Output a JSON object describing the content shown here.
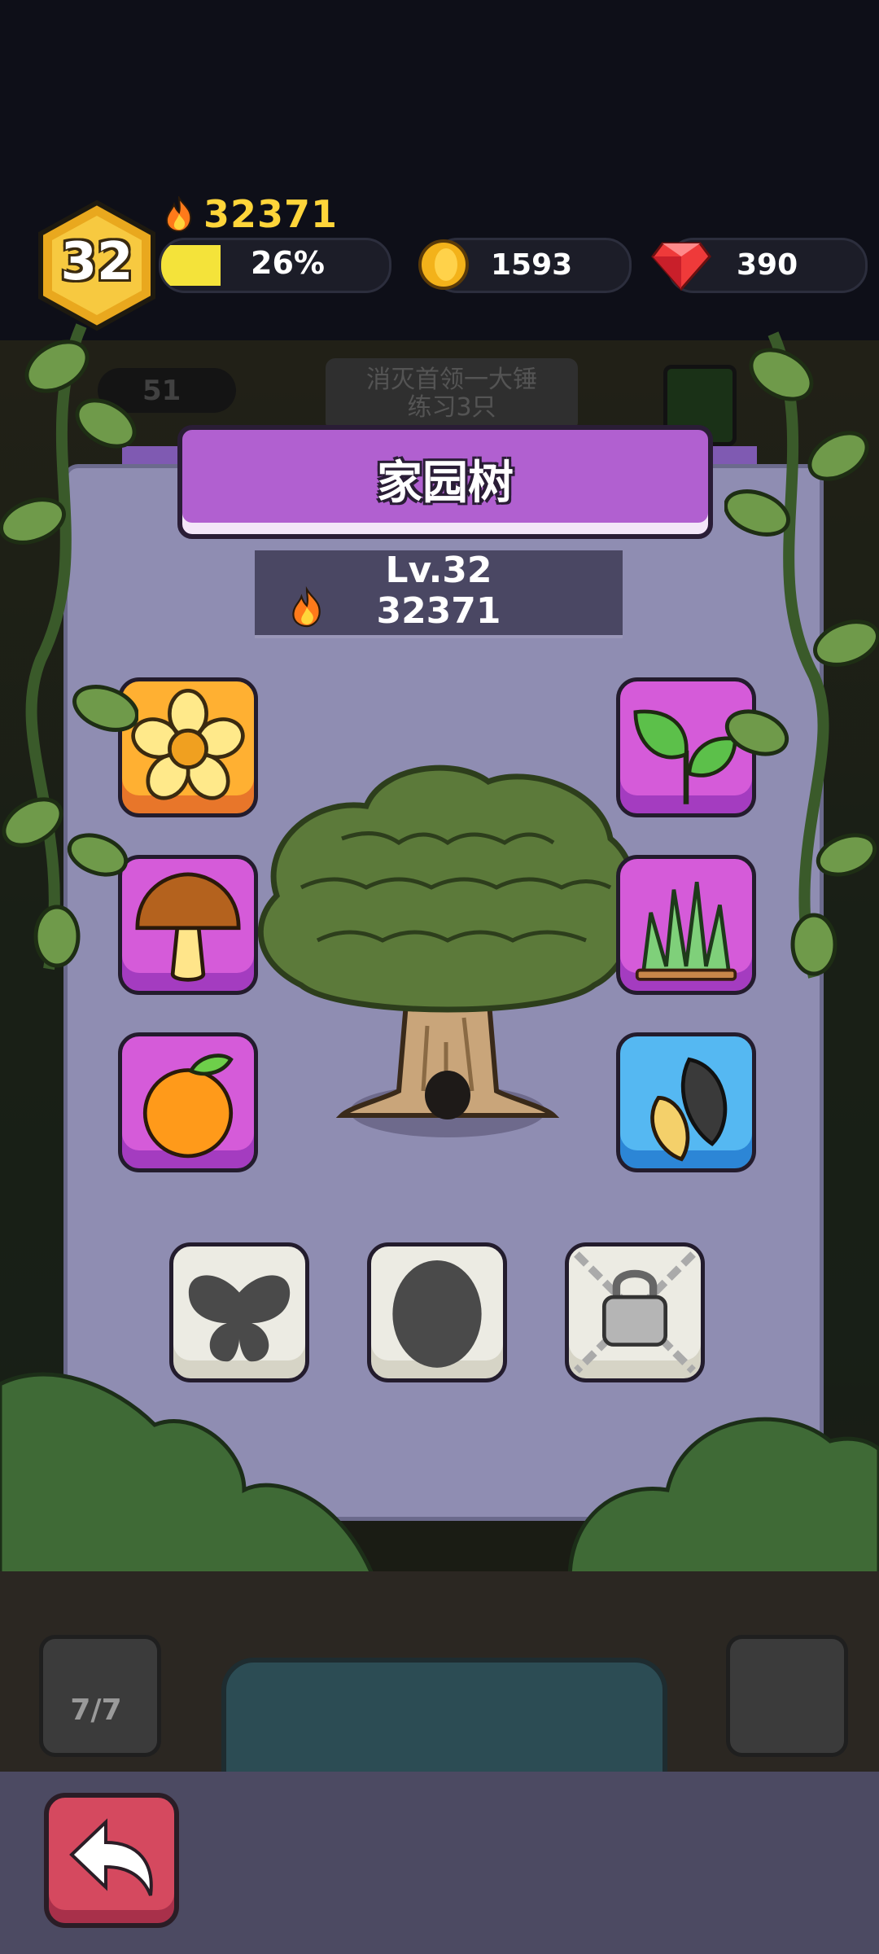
{
  "player": {
    "level": "32",
    "power": "32371",
    "xp_percent_label": "26%",
    "xp_fraction": 0.26
  },
  "currency": {
    "coins": "1593",
    "gems": "390"
  },
  "background": {
    "counter": "51",
    "quest_text": "消灭首领一大锤\n练习3只",
    "dock_left_count": "7/7"
  },
  "panel": {
    "title": "家园树",
    "level_label": "Lv.32",
    "power": "32371"
  },
  "slots": [
    {
      "item": "flower-icon",
      "color": "orange",
      "state": "unlocked"
    },
    {
      "item": "leaf-sprout-icon",
      "color": "purple",
      "state": "unlocked"
    },
    {
      "item": "mushroom-icon",
      "color": "purple",
      "state": "unlocked"
    },
    {
      "item": "grass-icon",
      "color": "purple",
      "state": "unlocked"
    },
    {
      "item": "orange-fruit-icon",
      "color": "purple",
      "state": "unlocked"
    },
    {
      "item": "sunflower-seeds-icon",
      "color": "blue",
      "state": "unlocked"
    },
    {
      "item": "butterfly-silhouette-icon",
      "color": "gray",
      "state": "undiscovered"
    },
    {
      "item": "egg-silhouette-icon",
      "color": "gray",
      "state": "undiscovered"
    },
    {
      "item": "padlock-chains-icon",
      "color": "gray",
      "state": "locked"
    }
  ],
  "colors": {
    "gold": "#ffd53a",
    "xp_fill": "#f4e33a",
    "title_purple": "#b160d0",
    "panel": "#8f8db2",
    "back_button": "#d5495f"
  }
}
